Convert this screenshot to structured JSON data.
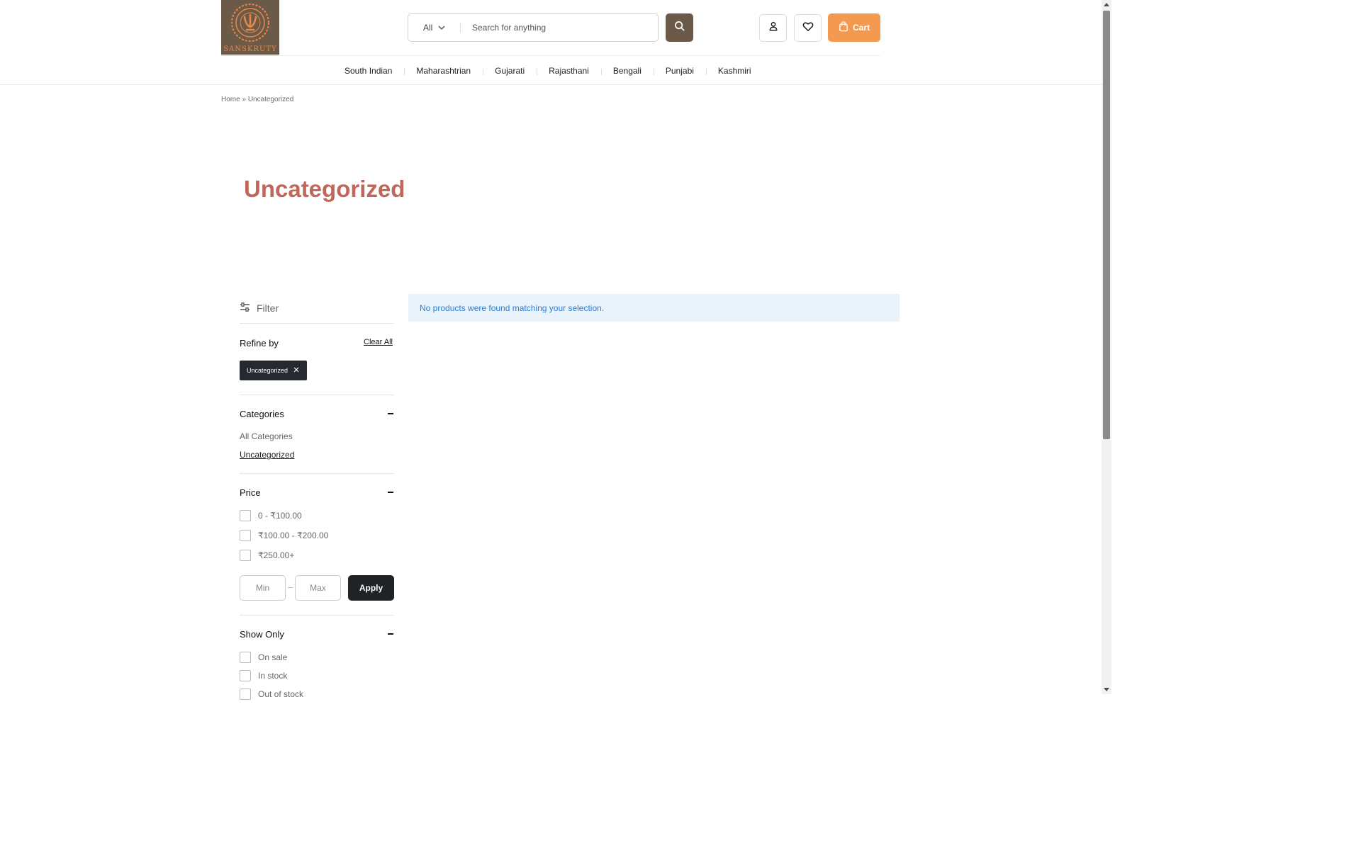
{
  "brand": {
    "logo_text": "SANSKRUTY"
  },
  "search": {
    "category": "All",
    "placeholder": "Search for anything"
  },
  "header": {
    "cart_label": "Cart"
  },
  "nav": {
    "items": [
      "South Indian",
      "Maharashtrian",
      "Gujarati",
      "Rajasthani",
      "Bengali",
      "Punjabi",
      "Kashmiri"
    ]
  },
  "breadcrumb": {
    "home": "Home",
    "separator": "»",
    "current": "Uncategorized"
  },
  "page": {
    "title": "Uncategorized"
  },
  "sidebar": {
    "filter_label": "Filter",
    "refine_label": "Refine by",
    "clear_all": "Clear All",
    "active_chip": "Uncategorized",
    "categories": {
      "title": "Categories",
      "items": [
        "All Categories",
        "Uncategorized"
      ]
    },
    "price": {
      "title": "Price",
      "ranges": [
        "0 - ₹100.00",
        "₹100.00 - ₹200.00",
        "₹250.00+"
      ],
      "min_placeholder": "Min",
      "max_placeholder": "Max",
      "apply_label": "Apply"
    },
    "show_only": {
      "title": "Show Only",
      "items": [
        "On sale",
        "In stock",
        "Out of stock"
      ]
    }
  },
  "main": {
    "notice": "No products were found matching your selection."
  },
  "colors": {
    "brand_brown": "#6b5a47",
    "cart_orange": "#f39a50",
    "title_red": "#c0665a",
    "notice_bg": "#e8f3fc",
    "notice_text": "#2a7fd4",
    "dark_button": "#1f2328"
  },
  "icons": {
    "search": "search-icon",
    "account": "user-icon",
    "wishlist": "heart-icon",
    "cart": "bag-icon",
    "filter": "sliders-icon",
    "remove": "close-icon",
    "collapse": "minus-icon",
    "dropdown": "chevron-down-icon"
  }
}
